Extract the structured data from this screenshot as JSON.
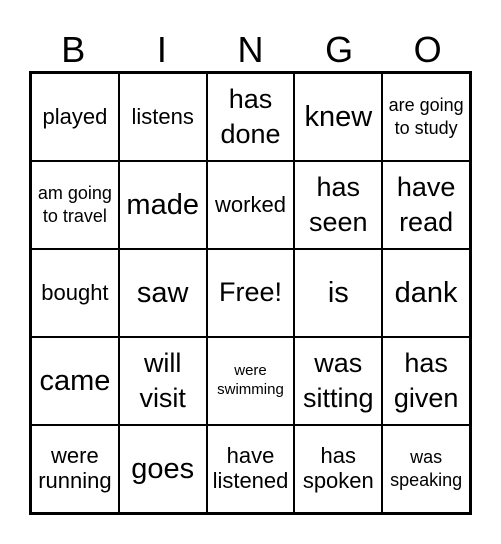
{
  "header": {
    "letters": [
      "B",
      "I",
      "N",
      "G",
      "O"
    ]
  },
  "board": {
    "cells": [
      [
        "played",
        "listens",
        "has done",
        "knew",
        "are going to study"
      ],
      [
        "am going to travel",
        "made",
        "worked",
        "has seen",
        "have read"
      ],
      [
        "bought",
        "saw",
        "Free!",
        "is",
        "dank"
      ],
      [
        "came",
        "will visit",
        "were swimming",
        "was sitting",
        "has given"
      ],
      [
        "were running",
        "goes",
        "have listened",
        "has spoken",
        "was speaking"
      ]
    ]
  },
  "colors": {
    "line": "#000000",
    "background": "#ffffff",
    "text": "#000000"
  }
}
